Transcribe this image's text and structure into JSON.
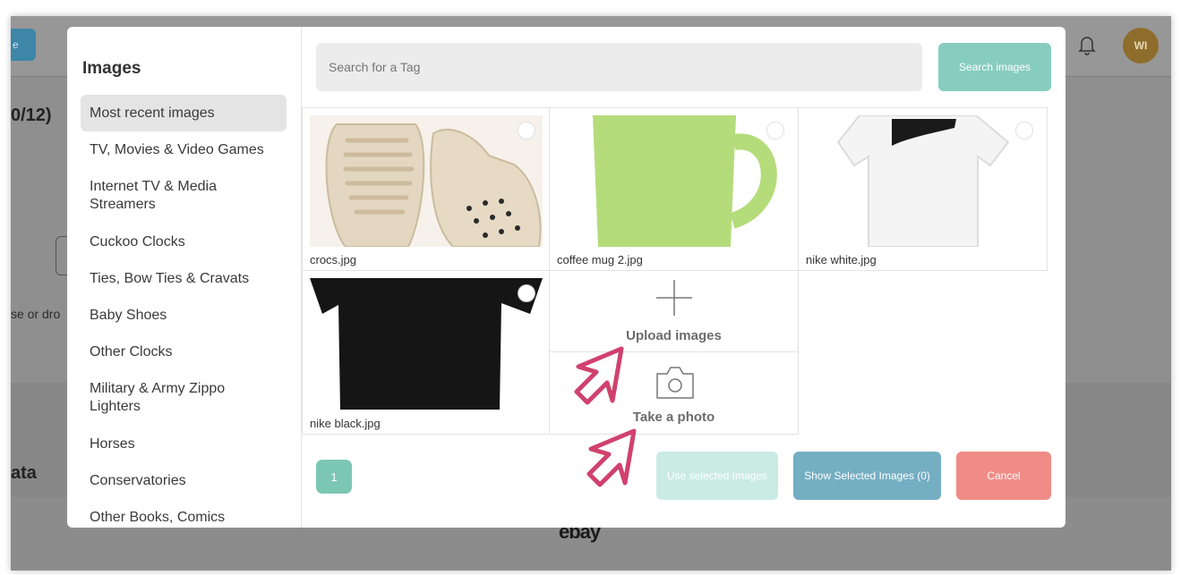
{
  "background": {
    "top_button_label": "e",
    "avatar_initials": "WI",
    "page_title": "0/12)",
    "drop_text": "se or dro",
    "data_heading": "ata",
    "footer_brand": "ebay"
  },
  "modal": {
    "heading": "Images",
    "categories": [
      {
        "label": "Most recent images",
        "active": true
      },
      {
        "label": "TV, Movies & Video Games"
      },
      {
        "label": "Internet TV & Media Streamers"
      },
      {
        "label": "Cuckoo Clocks"
      },
      {
        "label": "Ties, Bow Ties & Cravats"
      },
      {
        "label": "Baby Shoes"
      },
      {
        "label": "Other Clocks"
      },
      {
        "label": "Military & Army Zippo Lighters"
      },
      {
        "label": "Horses"
      },
      {
        "label": "Conservatories"
      },
      {
        "label": "Other Books, Comics"
      }
    ],
    "search": {
      "placeholder": "Search for a Tag",
      "value": "",
      "button_label": "Search images"
    },
    "images": [
      {
        "name": "crocs.jpg"
      },
      {
        "name": "coffee mug 2.jpg"
      },
      {
        "name": "nike white.jpg"
      },
      {
        "name": "nike black.jpg"
      }
    ],
    "upload_label": "Upload images",
    "photo_label": "Take a photo",
    "pagination": {
      "current": "1"
    },
    "buttons": {
      "use_selected": "Use selected Images",
      "show_selected": "Show Selected Images (0)",
      "cancel": "Cancel"
    },
    "colors": {
      "accent": "#87cdbf",
      "show_selected": "#74aec2",
      "cancel": "#f08c86",
      "annotation": "#d0416e"
    }
  }
}
